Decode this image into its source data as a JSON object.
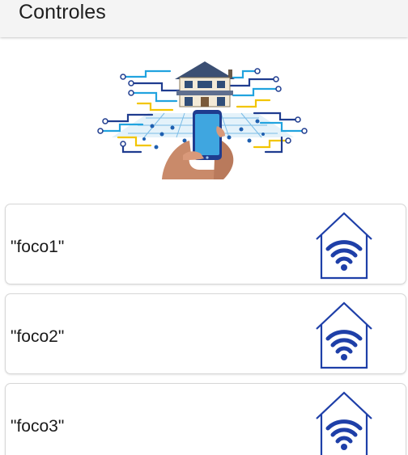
{
  "appbar": {
    "title": "Controles"
  },
  "devices": [
    {
      "label": "\"foco1\"",
      "icon": "smart-home-wifi-icon"
    },
    {
      "label": "\"foco2\"",
      "icon": "smart-home-wifi-icon"
    },
    {
      "label": "\"foco3\"",
      "icon": "smart-home-wifi-icon"
    }
  ],
  "colors": {
    "accent": "#1e3fa8",
    "appbar_bg": "#f4f4f4",
    "card_border": "#d7d7d7"
  }
}
